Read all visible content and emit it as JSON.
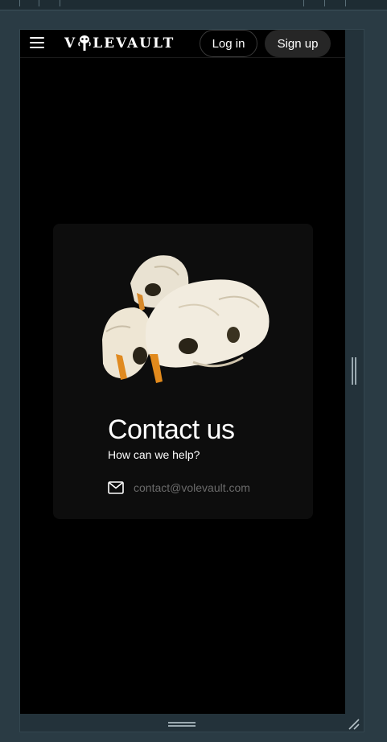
{
  "header": {
    "logo_text_left": "V",
    "logo_text_right": "LEVAULT",
    "login_label": "Log in",
    "signup_label": "Sign up"
  },
  "contact": {
    "title": "Contact us",
    "subtitle": "How can we help?",
    "email": "contact@volevault.com",
    "email_icon": "mail-icon"
  },
  "icons": {
    "menu": "hamburger-menu-icon",
    "logo_mark": "vole-skull-icon",
    "resize": "resize-grip-icon"
  },
  "colors": {
    "page_background": "#000000",
    "card_background": "#0d0d0d",
    "text_primary": "#ffffff",
    "text_muted": "#6b6b6b",
    "signup_button": "#262626",
    "frame": "#2a3b44"
  }
}
